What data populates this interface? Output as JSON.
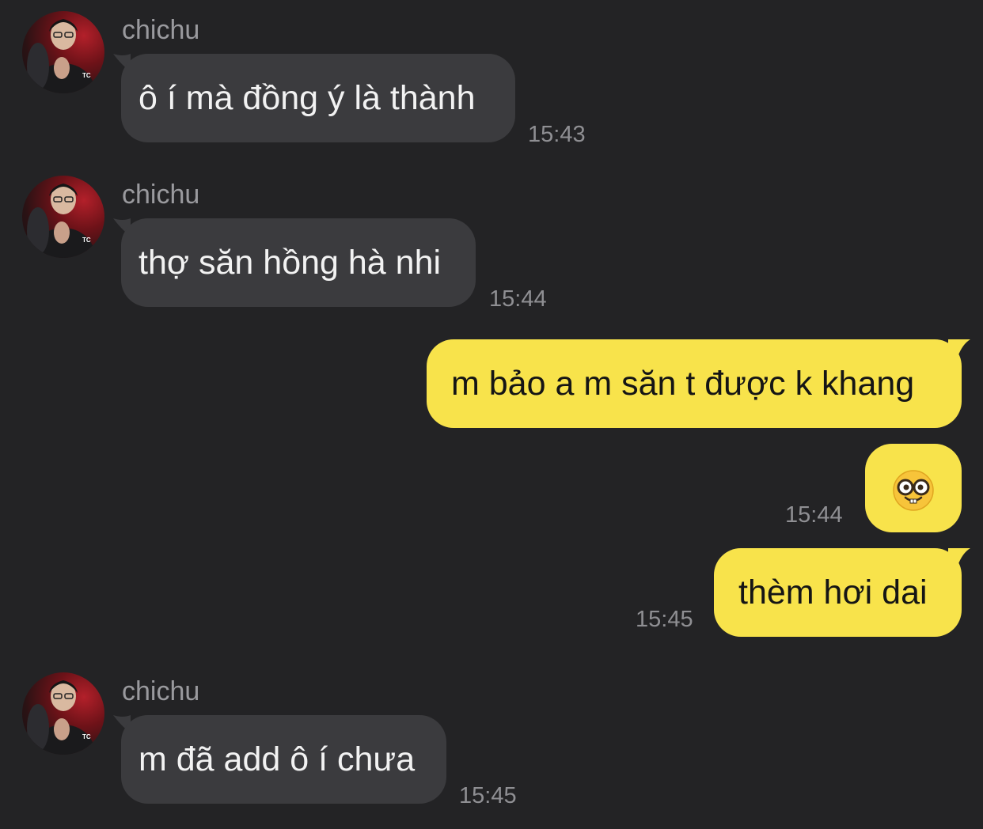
{
  "messages": [
    {
      "type": "incoming",
      "sender": "chichu",
      "text": "ô í mà đồng ý là thành",
      "time": "15:43"
    },
    {
      "type": "incoming",
      "sender": "chichu",
      "text": "thợ săn hồng hà nhi",
      "time": "15:44"
    },
    {
      "type": "outgoing",
      "text": "m bảo a m săn t được k khang"
    },
    {
      "type": "outgoing",
      "emoji": "nerd-face-emoji",
      "time": "15:44"
    },
    {
      "type": "outgoing",
      "text": "thèm hơi dai",
      "time": "15:45"
    },
    {
      "type": "incoming",
      "sender": "chichu",
      "text": "m đã add ô í chưa",
      "time": "15:45"
    }
  ],
  "colors": {
    "background": "#232325",
    "incoming_bubble": "#3b3b3e",
    "outgoing_bubble": "#f8e34b",
    "sender_text": "#9a9a9e",
    "timestamp": "#8f8f93"
  }
}
